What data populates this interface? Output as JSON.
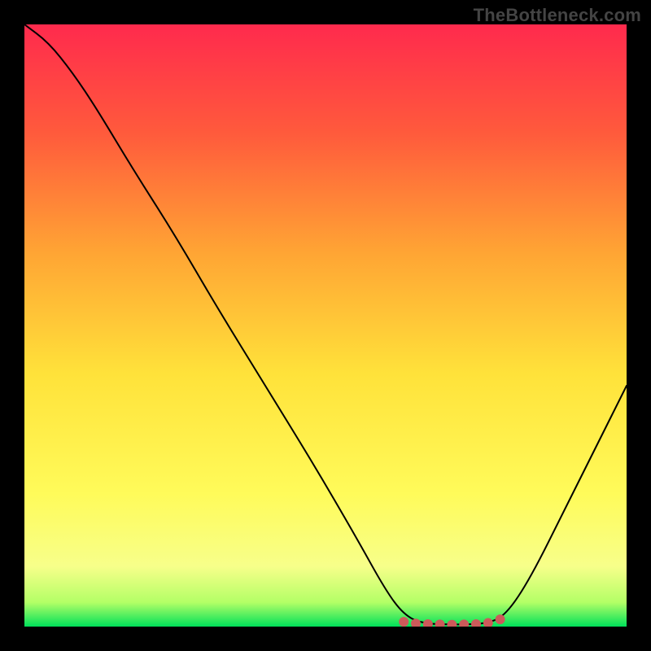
{
  "watermark": "TheBottleneck.com",
  "chart_data": {
    "type": "line",
    "title": "",
    "xlabel": "",
    "ylabel": "",
    "xlim": [
      0,
      100
    ],
    "ylim": [
      0,
      100
    ],
    "gradient_stops": [
      {
        "offset": 0,
        "color": "#ff2a4d"
      },
      {
        "offset": 18,
        "color": "#ff5a3c"
      },
      {
        "offset": 38,
        "color": "#ffa534"
      },
      {
        "offset": 58,
        "color": "#ffe23a"
      },
      {
        "offset": 78,
        "color": "#fffb5a"
      },
      {
        "offset": 90,
        "color": "#f7ff8a"
      },
      {
        "offset": 96,
        "color": "#b3ff66"
      },
      {
        "offset": 100,
        "color": "#00e05a"
      }
    ],
    "series": [
      {
        "name": "bottleneck-curve",
        "stroke": "#000000",
        "stroke_width": 2,
        "points": [
          {
            "x": 0,
            "y": 100
          },
          {
            "x": 4,
            "y": 97
          },
          {
            "x": 8,
            "y": 92
          },
          {
            "x": 12,
            "y": 86
          },
          {
            "x": 18,
            "y": 76
          },
          {
            "x": 25,
            "y": 65
          },
          {
            "x": 32,
            "y": 53
          },
          {
            "x": 40,
            "y": 40
          },
          {
            "x": 48,
            "y": 27
          },
          {
            "x": 55,
            "y": 15
          },
          {
            "x": 60,
            "y": 6
          },
          {
            "x": 63,
            "y": 2
          },
          {
            "x": 66,
            "y": 0.5
          },
          {
            "x": 72,
            "y": 0.3
          },
          {
            "x": 77,
            "y": 0.5
          },
          {
            "x": 80,
            "y": 2
          },
          {
            "x": 84,
            "y": 8
          },
          {
            "x": 90,
            "y": 20
          },
          {
            "x": 95,
            "y": 30
          },
          {
            "x": 100,
            "y": 40
          }
        ]
      }
    ],
    "markers": {
      "name": "trough-markers",
      "color": "#cc5a5a",
      "radius": 6,
      "points": [
        {
          "x": 63,
          "y": 0.8
        },
        {
          "x": 65,
          "y": 0.5
        },
        {
          "x": 67,
          "y": 0.4
        },
        {
          "x": 69,
          "y": 0.35
        },
        {
          "x": 71,
          "y": 0.3
        },
        {
          "x": 73,
          "y": 0.35
        },
        {
          "x": 75,
          "y": 0.4
        },
        {
          "x": 77,
          "y": 0.6
        },
        {
          "x": 79,
          "y": 1.2
        }
      ]
    }
  }
}
